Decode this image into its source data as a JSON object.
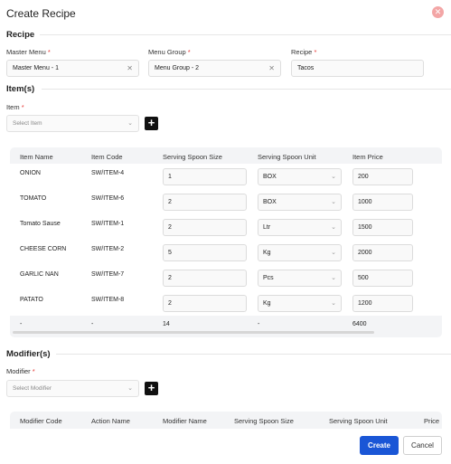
{
  "title": "Create Recipe",
  "recipe_section": "Recipe",
  "fields": {
    "master_menu": {
      "label": "Master Menu",
      "req": "*",
      "value": "Master Menu - 1"
    },
    "menu_group": {
      "label": "Menu Group",
      "req": "*",
      "value": "Menu Group - 2"
    },
    "recipe": {
      "label": "Recipe",
      "req": "*",
      "value": "Tacos"
    }
  },
  "items_section": "Item(s)",
  "item_select": {
    "label": "Item",
    "req": "*",
    "placeholder": "Select Item"
  },
  "items_table": {
    "headers": [
      "Item Name",
      "Item Code",
      "Serving Spoon Size",
      "Serving Spoon Unit",
      "Item Price"
    ],
    "rows": [
      {
        "name": "ONION",
        "code": "SW/ITEM-4",
        "size": "1",
        "unit": "BOX",
        "price": "200"
      },
      {
        "name": "TOMATO",
        "code": "SW/ITEM-6",
        "size": "2",
        "unit": "BOX",
        "price": "1000"
      },
      {
        "name": "Tomato Sause",
        "code": "SW/ITEM-1",
        "size": "2",
        "unit": "Ltr",
        "price": "1500"
      },
      {
        "name": "CHEESE CORN",
        "code": "SW/ITEM-2",
        "size": "5",
        "unit": "Kg",
        "price": "2000"
      },
      {
        "name": "GARLIC NAN",
        "code": "SW/ITEM-7",
        "size": "2",
        "unit": "Pcs",
        "price": "500"
      },
      {
        "name": "PATATO",
        "code": "SW/ITEM-8",
        "size": "2",
        "unit": "Kg",
        "price": "1200"
      }
    ],
    "totals": {
      "name": "-",
      "code": "-",
      "size": "14",
      "unit": "-",
      "price": "6400"
    }
  },
  "modifier_section": "Modifier(s)",
  "modifier_select": {
    "label": "Modifier",
    "req": "*",
    "placeholder": "Select Modifier"
  },
  "modifier_table": {
    "headers": [
      "Modifier Code",
      "Action Name",
      "Modifier Name",
      "Serving Spoon Size",
      "Serving Spoon Unit",
      "Price"
    ]
  },
  "buttons": {
    "create": "Create",
    "cancel": "Cancel"
  },
  "icons": {
    "close": "close-icon",
    "clear": "clear-icon",
    "chevron": "chevron-down-icon",
    "plus": "plus-icon"
  },
  "colors": {
    "primary": "#1a56d6",
    "close": "#f3a6a6",
    "required": "#e53935"
  }
}
